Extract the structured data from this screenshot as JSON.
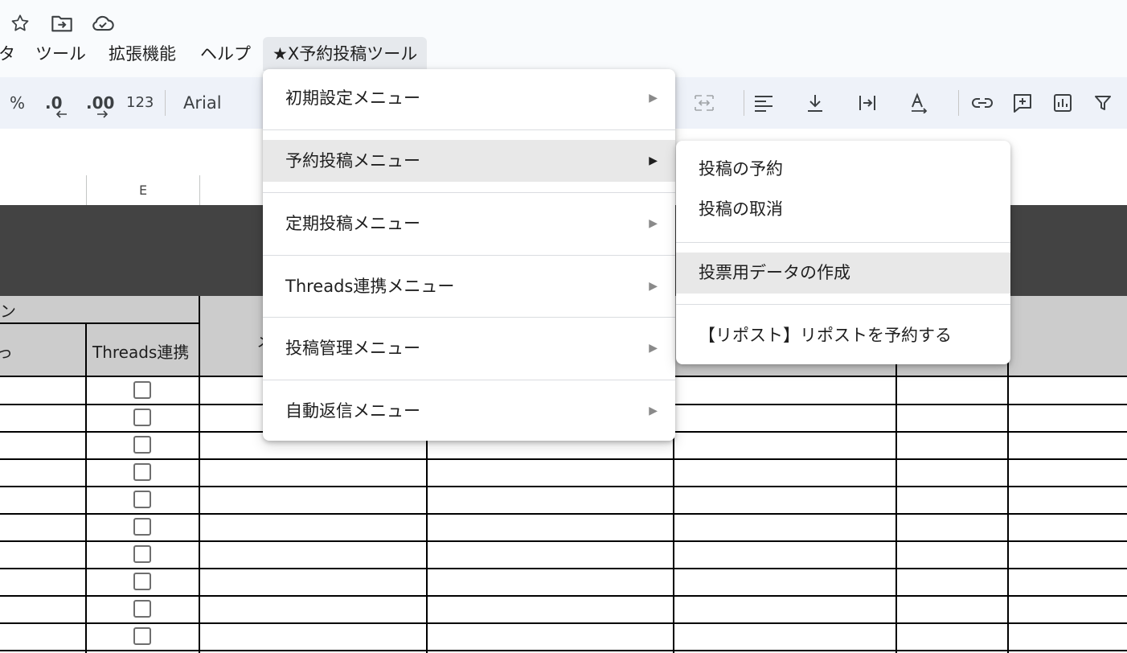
{
  "menubar": {
    "items": [
      {
        "label": "タ"
      },
      {
        "label": "ツール"
      },
      {
        "label": "拡張機能"
      },
      {
        "label": "ヘルプ"
      },
      {
        "label": "★X予約投稿ツール"
      }
    ]
  },
  "toolbar": {
    "percent": "%",
    "decrease_decimal": ".0",
    "increase_decimal": ".00",
    "number_format": "123",
    "font": "Arial"
  },
  "sheet": {
    "column_e": "E",
    "group_header_partial": "ン",
    "col_b_partial": "っ",
    "col_e_header": "Threads連携",
    "col_f_partial": "メ"
  },
  "main_menu": {
    "items": [
      {
        "label": "初期設定メニュー",
        "arrow": "▶"
      },
      {
        "label": "予約投稿メニュー",
        "arrow": "▶"
      },
      {
        "label": "定期投稿メニュー",
        "arrow": "▶"
      },
      {
        "label": "Threads連携メニュー",
        "arrow": "▶"
      },
      {
        "label": "投稿管理メニュー",
        "arrow": "▶"
      },
      {
        "label": "自動返信メニュー",
        "arrow": "▶"
      }
    ]
  },
  "sub_menu": {
    "items": [
      {
        "label": "投稿の予約"
      },
      {
        "label": "投稿の取消"
      },
      {
        "label": "投票用データの作成"
      },
      {
        "label": "【リポスト】リポストを予約する"
      }
    ]
  }
}
